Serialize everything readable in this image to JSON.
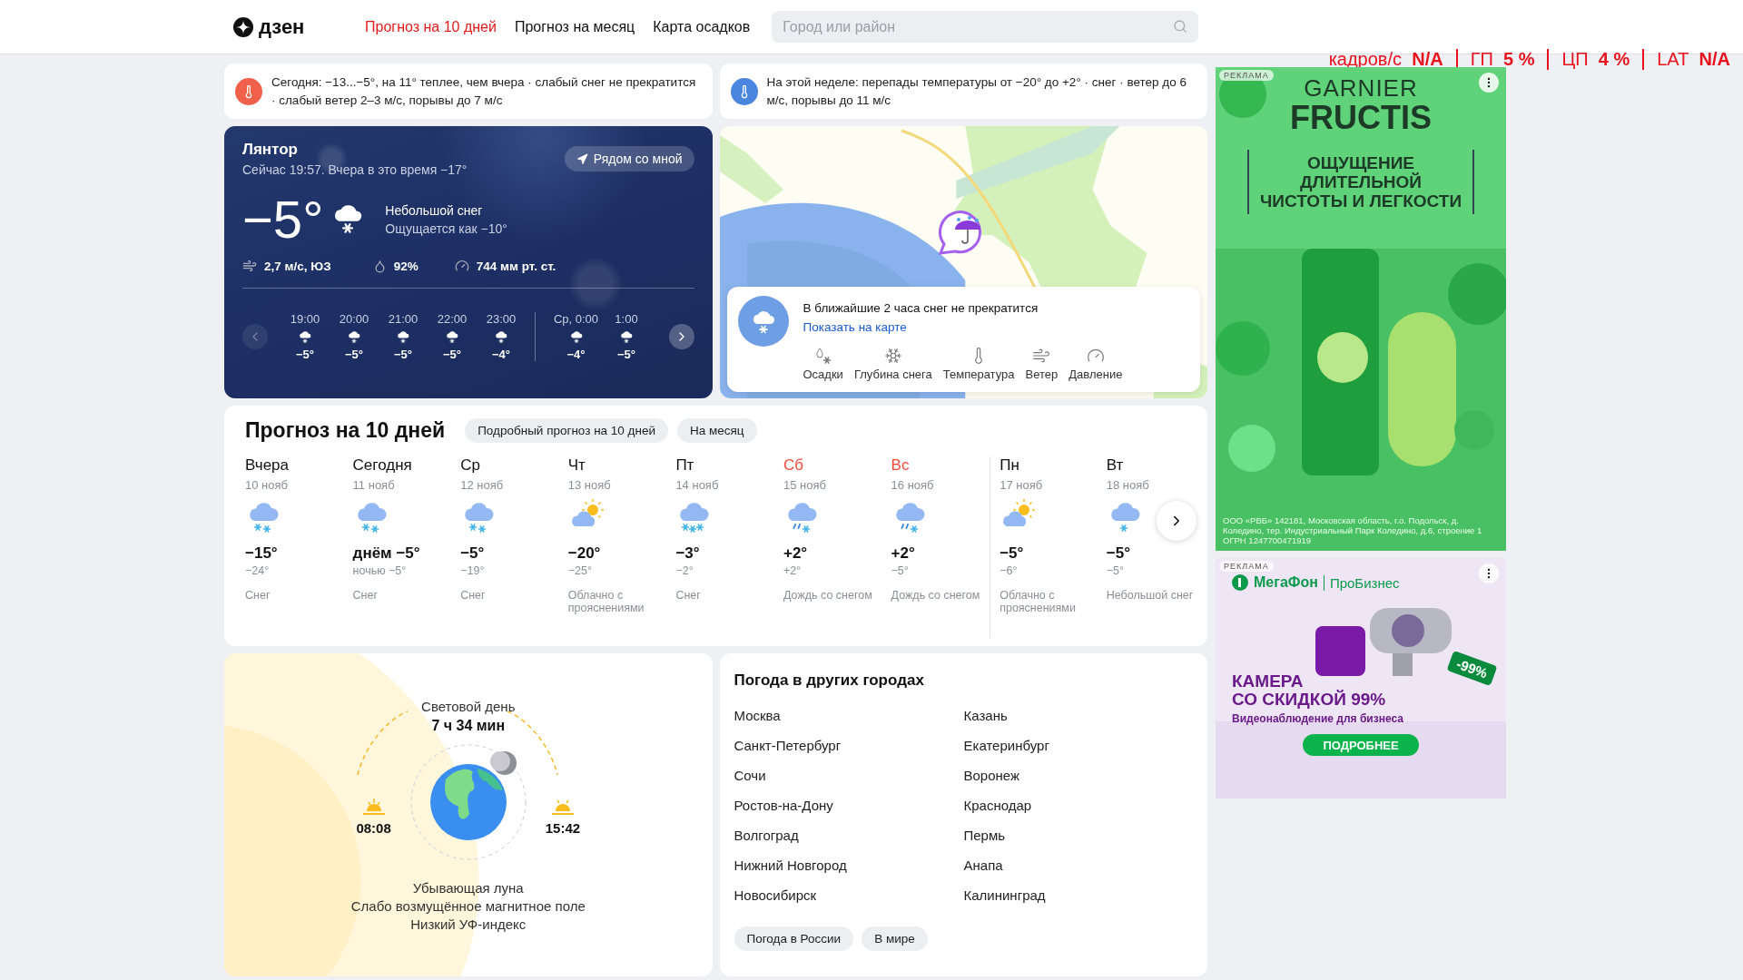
{
  "header": {
    "logo": "дзен",
    "nav": [
      {
        "label": "Прогноз на 10 дней",
        "selected": true
      },
      {
        "label": "Прогноз на месяц",
        "selected": false
      },
      {
        "label": "Карта осадков",
        "selected": false
      }
    ],
    "search": {
      "placeholder": "Город или район"
    }
  },
  "perf_overlay": [
    {
      "label": "кадров/с",
      "value": "N/A"
    },
    {
      "label": "ГП",
      "value": "5 %"
    },
    {
      "label": "ЦП",
      "value": "4 %"
    },
    {
      "label": "LAT",
      "value": "N/A"
    }
  ],
  "alerts": [
    {
      "kind": "today",
      "text": "Сегодня: −13...−5°, на 11° теплее, чем вчера · слабый снег не прекратится · слабый ветер 2–3 м/с, порывы до 7 м/с"
    },
    {
      "kind": "week",
      "text": "На этой неделе: перепады температуры от −20° до +2° · снег · ветер до 6 м/с, порывы до 11 м/с"
    }
  ],
  "current": {
    "city": "Лянтор",
    "subtitle": "Сейчас 19:57. Вчера в это время −17°",
    "nearby_button": "Рядом со мной",
    "temp": "−5°",
    "condition": "Небольшой снег",
    "feels_like": "Ощущается как −10°",
    "wind": "2,7 м/с, ЮЗ",
    "humidity": "92%",
    "pressure": "744 мм рт. ст.",
    "prev_disabled": true,
    "hours": [
      {
        "time": "19:00",
        "temp": "−5°",
        "new_day": false
      },
      {
        "time": "20:00",
        "temp": "−5°",
        "new_day": false
      },
      {
        "time": "21:00",
        "temp": "−5°",
        "new_day": false
      },
      {
        "time": "22:00",
        "temp": "−5°",
        "new_day": false
      },
      {
        "time": "23:00",
        "temp": "−4°",
        "new_day": false
      },
      {
        "time": "Ср, 0:00",
        "temp": "−4°",
        "new_day": true
      },
      {
        "time": "1:00",
        "temp": "−5°",
        "new_day": false
      }
    ]
  },
  "nowcast": {
    "message": "В ближайшие 2 часа снег не прекратится",
    "link": "Показать на карте",
    "layers": [
      {
        "kind": "precipitation",
        "label": "Осадки"
      },
      {
        "kind": "snow_depth",
        "label": "Глубина снега"
      },
      {
        "kind": "temperature",
        "label": "Температура"
      },
      {
        "kind": "wind",
        "label": "Ветер"
      },
      {
        "kind": "pressure",
        "label": "Давление"
      }
    ]
  },
  "forecast": {
    "title": "Прогноз на 10 дней",
    "buttons": [
      "Подробный прогноз на 10 дней",
      "На месяц"
    ],
    "days": [
      {
        "day": "Вчера",
        "date": "10 нояб",
        "weekend": false,
        "new_week": false,
        "kind": "snow",
        "temp": "−15°",
        "night": "−24°",
        "condition": "Снег"
      },
      {
        "day": "Сегодня",
        "date": "11 нояб",
        "weekend": false,
        "new_week": false,
        "kind": "snow",
        "temp": "днём −5°",
        "night": "ночью −5°",
        "condition": "Снег"
      },
      {
        "day": "Ср",
        "date": "12 нояб",
        "weekend": false,
        "new_week": false,
        "kind": "snow",
        "temp": "−5°",
        "night": "−19°",
        "condition": "Снег"
      },
      {
        "day": "Чт",
        "date": "13 нояб",
        "weekend": false,
        "new_week": false,
        "kind": "partly_cloudy",
        "temp": "−20°",
        "night": "−25°",
        "condition": "Облачно с прояснениями"
      },
      {
        "day": "Пт",
        "date": "14 нояб",
        "weekend": false,
        "new_week": false,
        "kind": "heavy_snow",
        "temp": "−3°",
        "night": "−2°",
        "condition": "Снег"
      },
      {
        "day": "Сб",
        "date": "15 нояб",
        "weekend": true,
        "new_week": false,
        "kind": "rain_snow",
        "temp": "+2°",
        "night": "+2°",
        "condition": "Дождь со снегом"
      },
      {
        "day": "Вс",
        "date": "16 нояб",
        "weekend": true,
        "new_week": false,
        "kind": "rain_snow",
        "temp": "+2°",
        "night": "−5°",
        "condition": "Дождь со снегом"
      },
      {
        "day": "Пн",
        "date": "17 нояб",
        "weekend": false,
        "new_week": true,
        "kind": "partly_cloudy",
        "temp": "−5°",
        "night": "−6°",
        "condition": "Облачно с прояснениями"
      },
      {
        "day": "Вт",
        "date": "18 нояб",
        "weekend": false,
        "new_week": false,
        "kind": "light_snow",
        "temp": "−5°",
        "night": "−5°",
        "condition": "Небольшой снег"
      }
    ]
  },
  "daylight": {
    "label": "Световой день",
    "duration": "7 ч 34 мин",
    "sunrise": "08:08",
    "sunset": "15:42",
    "notes": [
      "Убывающая луна",
      "Слабо возмущённое магнитное поле",
      "Низкий УФ-индекс"
    ]
  },
  "cities": {
    "title": "Погода в других городах",
    "columns": [
      {
        "items": [
          "Москва",
          "Санкт-Петербург",
          "Сочи",
          "Ростов-на-Дону",
          "Волгоград",
          "Нижний Новгород",
          "Новосибирск"
        ]
      },
      {
        "items": [
          "Казань",
          "Екатеринбург",
          "Воронеж",
          "Краснодар",
          "Пермь",
          "Анапа",
          "Калининград"
        ]
      }
    ],
    "buttons": [
      "Погода в России",
      "В мире"
    ]
  },
  "ads": [
    {
      "kind": "garnier",
      "label": "РЕКЛАМА",
      "brand": "GARNIER",
      "product": "FRUCTIS",
      "headline": [
        "ОЩУЩЕНИЕ",
        "ДЛИТЕЛЬНОЙ",
        "ЧИСТОТЫ И ЛЕГКОСТИ"
      ],
      "legal": "ООО «РВБ» 142181, Московская область, г.о. Подольск, д. Коледино, тер. Индустриальный Парк Коледино, д.6, строение 1 ОГРН 1247700471919"
    },
    {
      "kind": "megafon",
      "label": "РЕКЛАМА",
      "brand": "МегаФон",
      "sub": "ПроБизнес",
      "badge": "-99%",
      "headline": [
        "КАМЕРА",
        "СО СКИДКОЙ 99%"
      ],
      "tagline": "Видеонаблюдение для бизнеса",
      "cta": "ПОДРОБНЕЕ"
    }
  ]
}
